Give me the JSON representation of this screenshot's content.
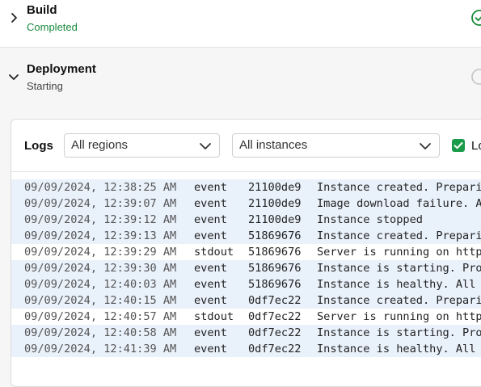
{
  "build": {
    "title": "Build",
    "status": "Completed",
    "status_color": "#1a8a3c",
    "status_icon": "check-circle-icon"
  },
  "deployment": {
    "title": "Deployment",
    "status": "Starting",
    "status_icon": "spinner-icon"
  },
  "logs": {
    "label": "Logs",
    "region_select": "All regions",
    "instance_select": "All instances",
    "checkbox_label": "Lo",
    "checkbox_checked": true,
    "accent_color": "#1a9b4a",
    "rows": [
      {
        "time": "09/09/2024, 12:38:25 AM",
        "type": "event",
        "id": "21100de9",
        "message": "Instance created. Prepari"
      },
      {
        "time": "09/09/2024, 12:39:07 AM",
        "type": "event",
        "id": "21100de9",
        "message": "Image download failure. A"
      },
      {
        "time": "09/09/2024, 12:39:12 AM",
        "type": "event",
        "id": "21100de9",
        "message": "Instance stopped"
      },
      {
        "time": "09/09/2024, 12:39:13 AM",
        "type": "event",
        "id": "51869676",
        "message": "Instance created. Prepari"
      },
      {
        "time": "09/09/2024, 12:39:29 AM",
        "type": "stdout",
        "id": "51869676",
        "message": "Server is running on http"
      },
      {
        "time": "09/09/2024, 12:39:30 AM",
        "type": "event",
        "id": "51869676",
        "message": "Instance is starting. Pro"
      },
      {
        "time": "09/09/2024, 12:40:03 AM",
        "type": "event",
        "id": "51869676",
        "message": "Instance is healthy. All"
      },
      {
        "time": "09/09/2024, 12:40:15 AM",
        "type": "event",
        "id": "0df7ec22",
        "message": "Instance created. Prepari"
      },
      {
        "time": "09/09/2024, 12:40:57 AM",
        "type": "stdout",
        "id": "0df7ec22",
        "message": "Server is running on http"
      },
      {
        "time": "09/09/2024, 12:40:58 AM",
        "type": "event",
        "id": "0df7ec22",
        "message": "Instance is starting. Pro"
      },
      {
        "time": "09/09/2024, 12:41:39 AM",
        "type": "event",
        "id": "0df7ec22",
        "message": "Instance is healthy. All"
      }
    ]
  }
}
